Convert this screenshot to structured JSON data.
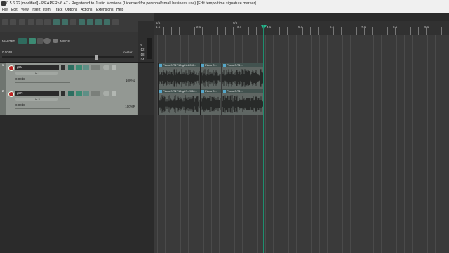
{
  "window": {
    "title": "0.5.6.22 [modified] - REAPER v6.47 - Registered to Justin Morrione (Licensed for personal/small business use)   [Edit tempo/time signature marker]"
  },
  "menu": [
    "File",
    "Edit",
    "View",
    "Insert",
    "Item",
    "Track",
    "Options",
    "Actions",
    "Extensions",
    "Help"
  ],
  "master": {
    "label": "MASTER",
    "volume": "0.00dB",
    "pan": "center",
    "mono_label": "MONO"
  },
  "tracks": [
    {
      "number": "1",
      "name": "gtrL",
      "input": "In 1",
      "volume": "0.00dB",
      "pan": "100%L"
    },
    {
      "number": "2",
      "name": "gtrR",
      "input": "In 2",
      "volume": "0.00dB",
      "pan": "100%R"
    }
  ],
  "ruler": {
    "labels": [
      "1.1",
      "2.1",
      "3.1",
      "4.1",
      "5.1",
      "6.1",
      "7.1",
      "8.1",
      "9.1"
    ],
    "top_markers": [
      "4/4",
      "6/8"
    ]
  },
  "items": [
    {
      "track": 1,
      "label": "Piano 0-T1T16-gtrL-2030..."
    },
    {
      "track": 1,
      "label": "Piano 0..."
    },
    {
      "track": 1,
      "label": "Piano 0-T1..."
    },
    {
      "track": 2,
      "label": "Piano 0-T1T16-gtrR-2030..."
    },
    {
      "track": 2,
      "label": "Piano 0..."
    },
    {
      "track": 2,
      "label": "Piano 0-T1..."
    }
  ],
  "meter_scale": [
    "-6",
    "-12",
    "-18",
    "-24"
  ],
  "colors": {
    "accent": "#27b58c",
    "record": "#b22222",
    "track_bg": "#939893",
    "arrange_bg": "#3a3a3a"
  }
}
